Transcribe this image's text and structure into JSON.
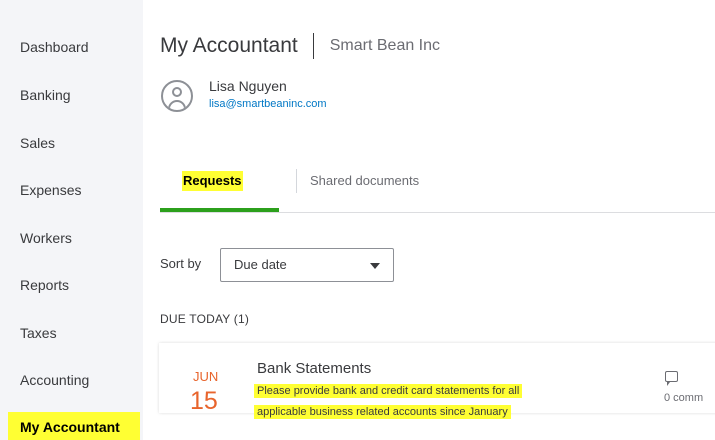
{
  "sidebar": {
    "items": [
      {
        "label": "Dashboard"
      },
      {
        "label": "Banking"
      },
      {
        "label": "Sales"
      },
      {
        "label": "Expenses"
      },
      {
        "label": "Workers"
      },
      {
        "label": "Reports"
      },
      {
        "label": "Taxes"
      },
      {
        "label": "Accounting"
      },
      {
        "label": "My Accountant",
        "active": true
      }
    ]
  },
  "header": {
    "title": "My Accountant",
    "company": "Smart Bean Inc"
  },
  "accountant": {
    "name": "Lisa Nguyen",
    "email": "lisa@smartbeaninc.com"
  },
  "tabs": [
    {
      "label": "Requests",
      "active": true
    },
    {
      "label": "Shared documents"
    }
  ],
  "sort": {
    "label": "Sort by",
    "selected": "Due date"
  },
  "sections": [
    {
      "heading": "DUE TODAY (1)",
      "requests": [
        {
          "due_month": "JUN",
          "due_day": "15",
          "title": "Bank Statements",
          "description_line1": "Please provide bank and credit card statements for all",
          "description_line2": "applicable business related accounts since January",
          "comment_count": "0 comm"
        }
      ]
    }
  ],
  "colors": {
    "highlight": "#ffff33",
    "active_tab": "#2ca01c",
    "due_date": "#e8642c",
    "link": "#0077c5"
  }
}
